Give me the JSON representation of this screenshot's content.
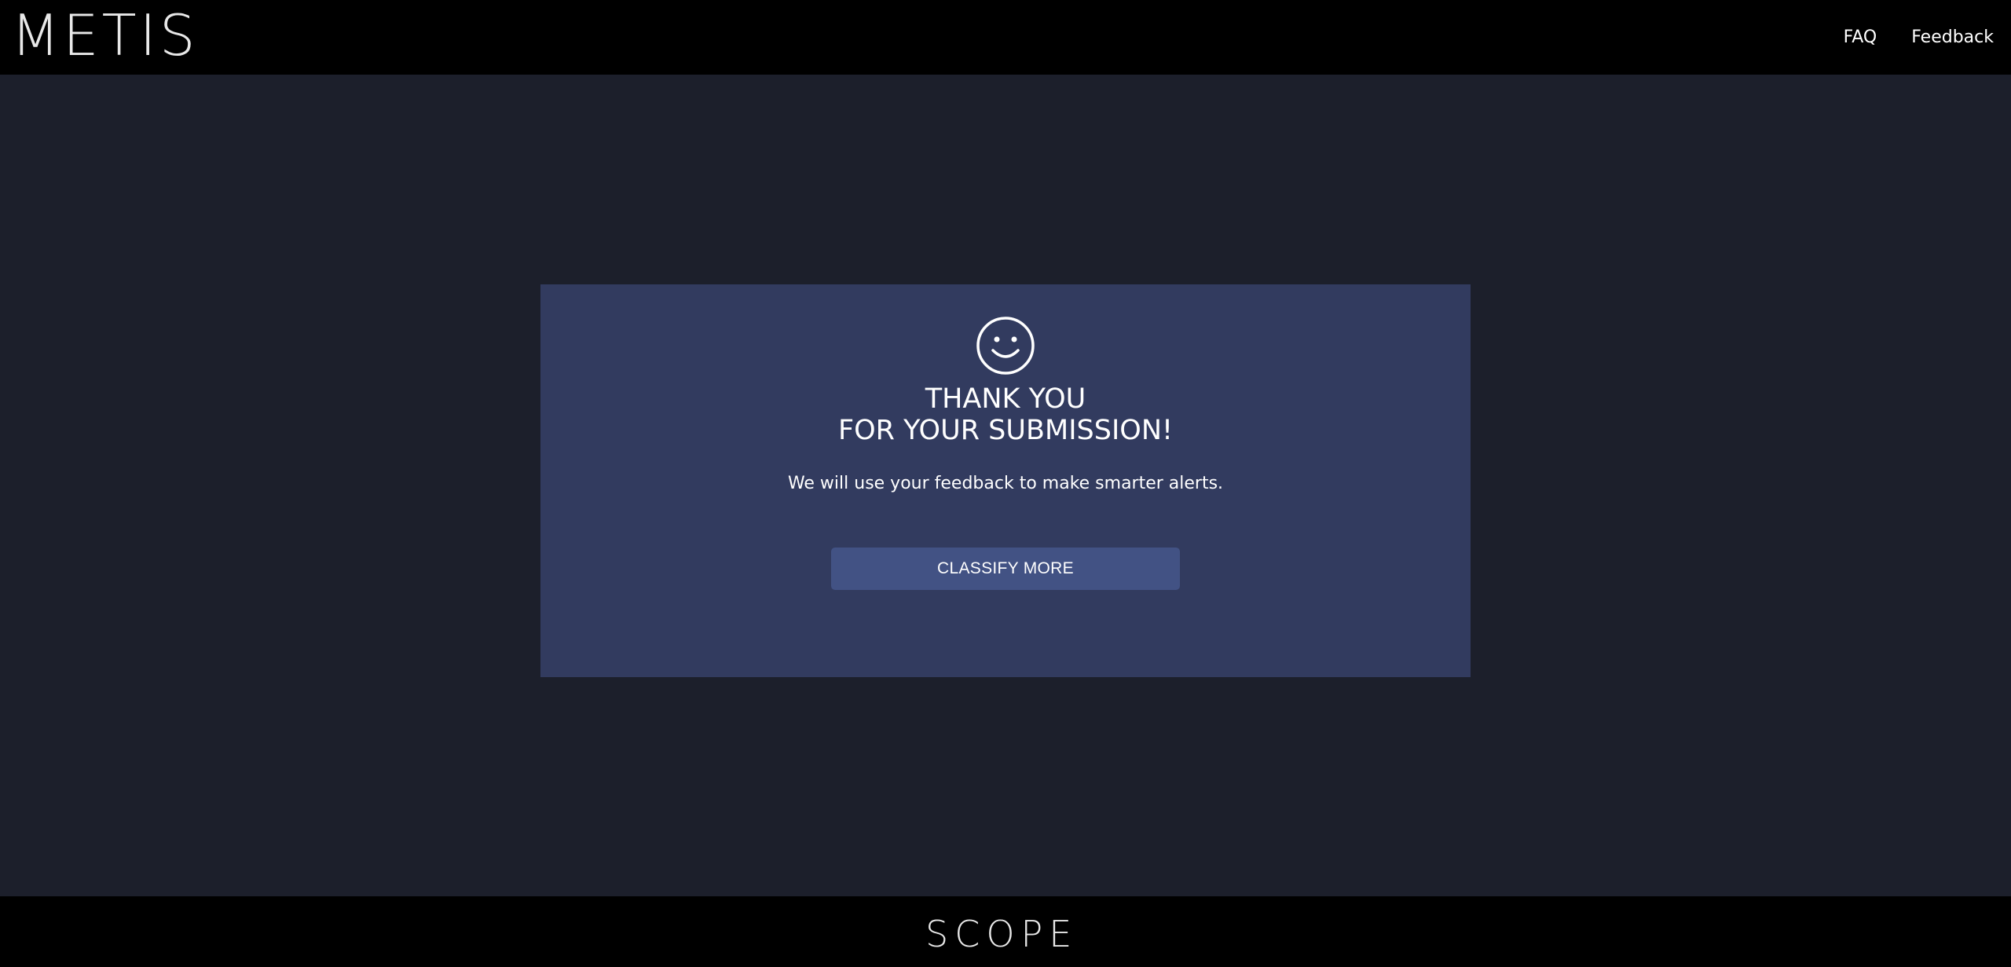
{
  "header": {
    "logo_text": "METIS",
    "nav": [
      {
        "label": "FAQ"
      },
      {
        "label": "Feedback"
      }
    ]
  },
  "card": {
    "icon": "smiley-icon",
    "title_line1": "THANK YOU",
    "title_line2": "FOR YOUR SUBMISSION!",
    "message": "We will use your feedback to make smarter alerts.",
    "button_label": "CLASSIFY MORE"
  },
  "footer": {
    "logo_text": "SCOPE"
  },
  "colors": {
    "background": "#1c1f2b",
    "bar": "#000000",
    "card": "#323b5f",
    "button": "#425284",
    "text": "#ffffff"
  }
}
